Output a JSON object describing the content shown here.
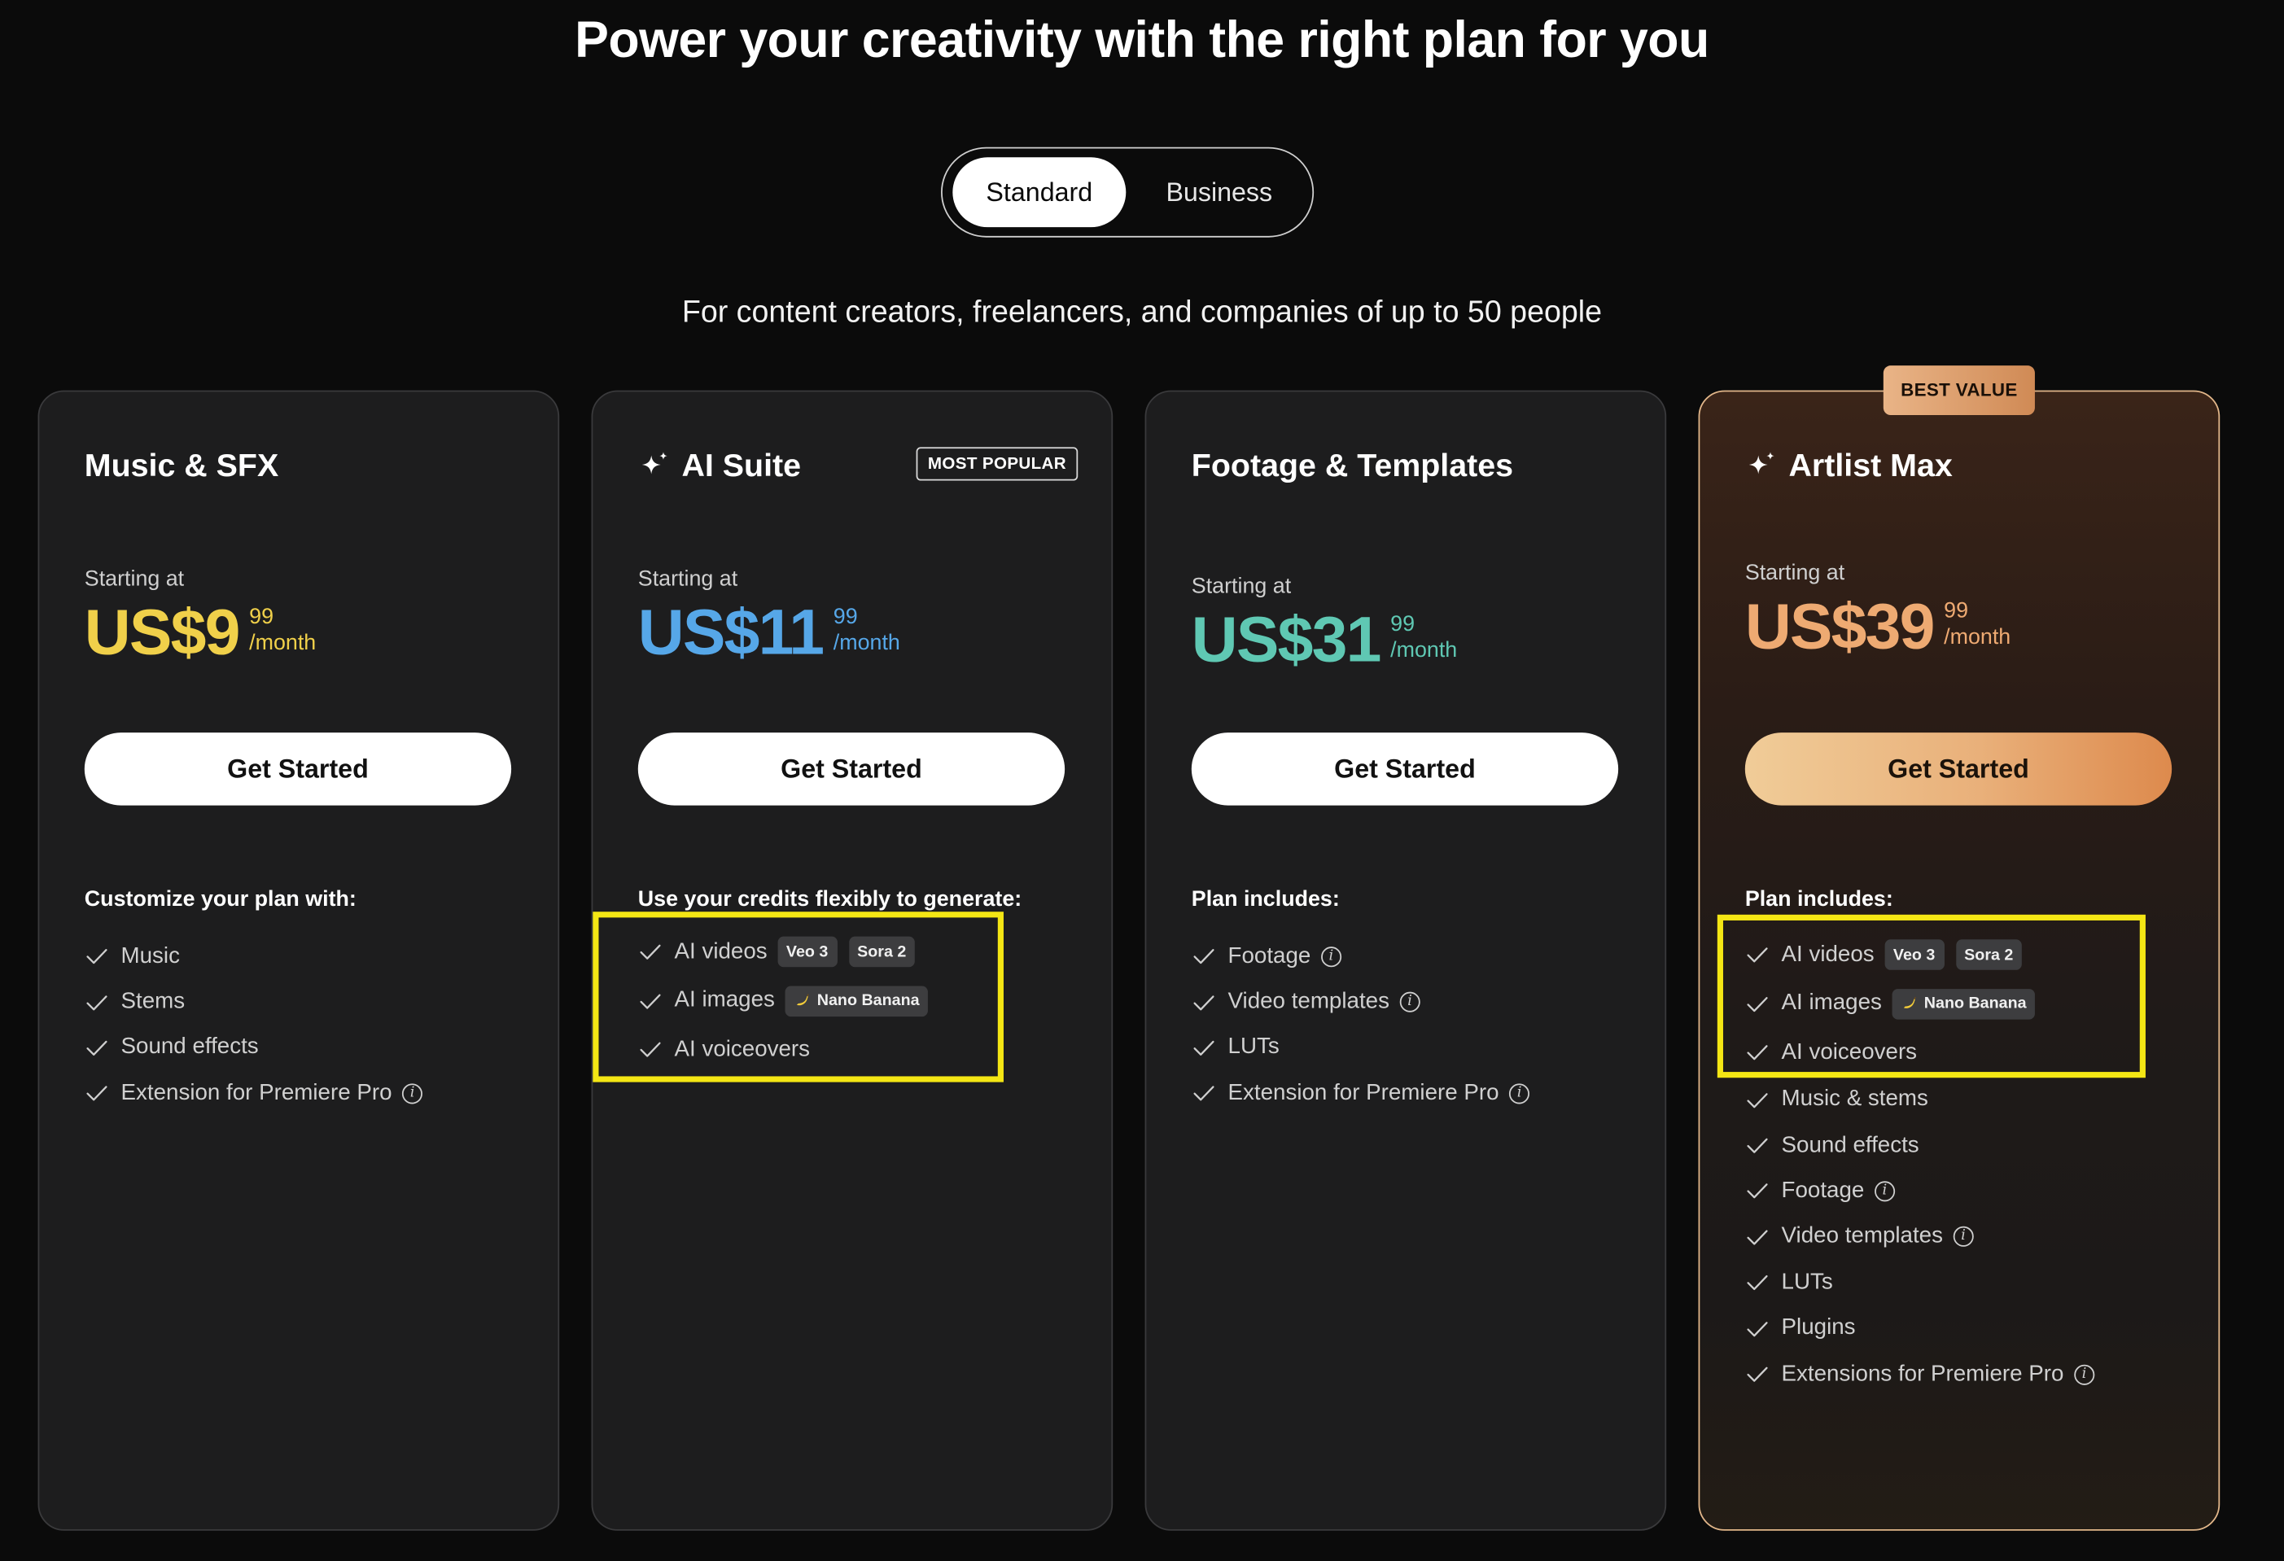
{
  "page": {
    "headline": "Power your creativity with the right plan for you",
    "subheadline": "For content creators, freelancers, and companies of up to 50 people"
  },
  "toggle": {
    "standard": "Standard",
    "business": "Business"
  },
  "colors": {
    "music": "#f0d04a",
    "ai": "#56a7e8",
    "footage": "#5fc8b3",
    "max": "#eeaa72",
    "highlight": "#f4e614"
  },
  "plans": [
    {
      "title": "Music & SFX",
      "starting": "Starting at",
      "price": "US$9",
      "cents": "99",
      "period": "/month",
      "cta": "Get Started",
      "features_title": "Customize your plan with:",
      "features": [
        {
          "label": "Music"
        },
        {
          "label": "Stems"
        },
        {
          "label": "Sound effects"
        },
        {
          "label": "Extension for Premiere Pro",
          "info": true
        }
      ]
    },
    {
      "title": "AI Suite",
      "badge": "MOST POPULAR",
      "icon": "sparkle-icon",
      "starting": "Starting at",
      "price": "US$11",
      "cents": "99",
      "period": "/month",
      "cta": "Get Started",
      "features_title": "Use your credits flexibly to generate:",
      "features": [
        {
          "label": "AI videos",
          "tags": [
            "Veo 3",
            "Sora 2"
          ]
        },
        {
          "label": "AI images",
          "tags": [
            "Nano Banana"
          ]
        },
        {
          "label": "AI voiceovers"
        }
      ]
    },
    {
      "title": "Footage & Templates",
      "starting": "Starting at",
      "price": "US$31",
      "cents": "99",
      "period": "/month",
      "cta": "Get Started",
      "features_title": "Plan includes:",
      "features": [
        {
          "label": "Footage",
          "info": true
        },
        {
          "label": "Video templates",
          "info": true
        },
        {
          "label": "LUTs"
        },
        {
          "label": "Extension for Premiere Pro",
          "info": true
        }
      ]
    },
    {
      "title": "Artlist Max",
      "badge": "BEST VALUE",
      "icon": "sparkle-icon",
      "starting": "Starting at",
      "price": "US$39",
      "cents": "99",
      "period": "/month",
      "cta": "Get Started",
      "features_title": "Plan includes:",
      "features": [
        {
          "label": "AI videos",
          "tags": [
            "Veo 3",
            "Sora 2"
          ]
        },
        {
          "label": "AI images",
          "tags": [
            "Nano Banana"
          ]
        },
        {
          "label": "AI voiceovers"
        },
        {
          "label": "Music & stems"
        },
        {
          "label": "Sound effects"
        },
        {
          "label": "Footage",
          "info": true
        },
        {
          "label": "Video templates",
          "info": true
        },
        {
          "label": "LUTs"
        },
        {
          "label": "Plugins"
        },
        {
          "label": "Extensions for Premiere Pro",
          "info": true
        }
      ]
    }
  ]
}
